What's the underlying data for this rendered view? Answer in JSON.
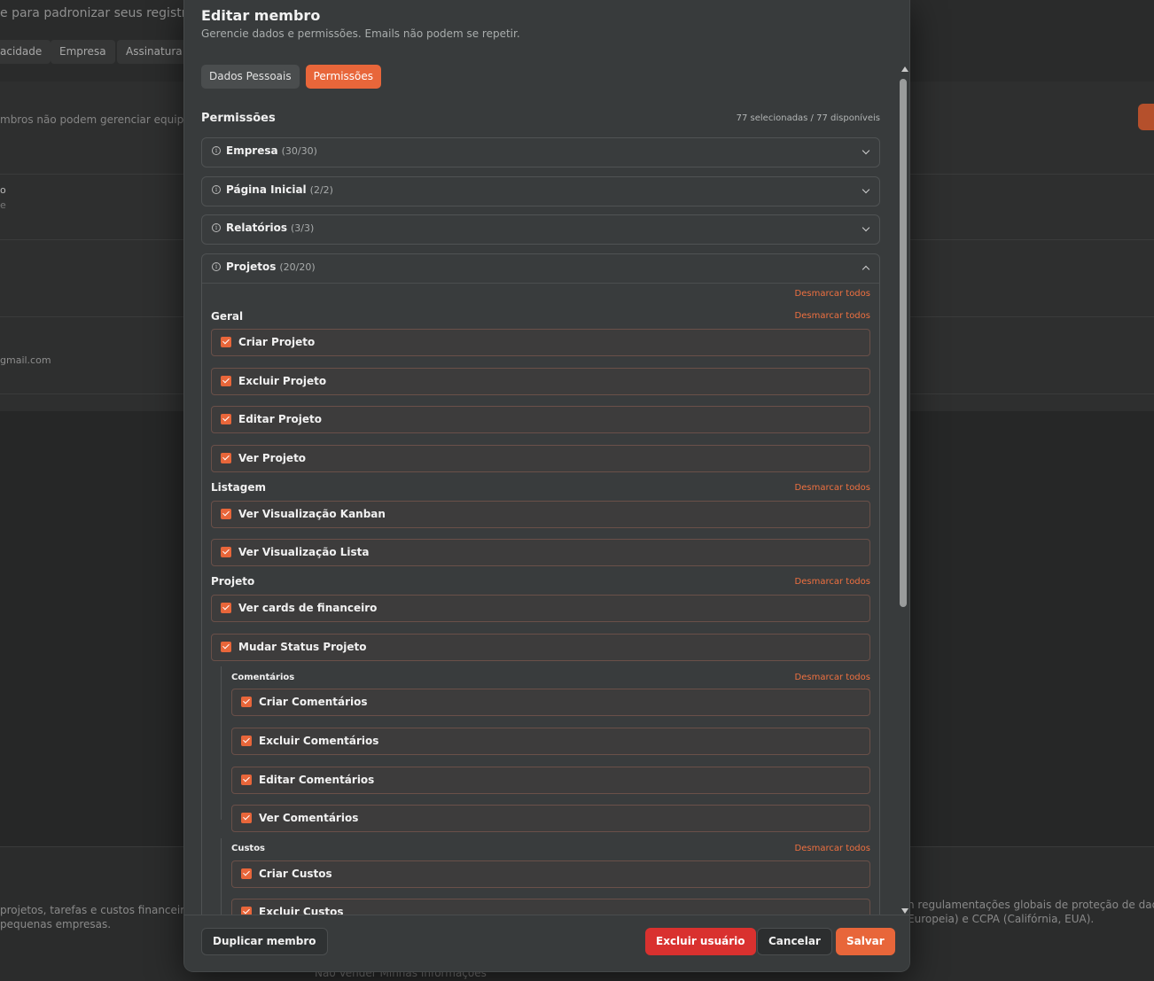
{
  "background": {
    "subtitle": "e para padronizar seus registros.",
    "tabs": [
      "acidade",
      "Empresa",
      "Assinatura"
    ],
    "note": "mbros não podem gerenciar equipe o",
    "row_a": "o",
    "row_b": "e",
    "email": "gmail.com",
    "footer_left_1": "projetos, tarefas e custos financeiros",
    "footer_left_2": "pequenas empresas.",
    "footer_right_1": "n regulamentações globais de proteção de dados,",
    "footer_right_2": "Europeia) e CCPA (Califórnia, EUA).",
    "footer_link": "Não Vender Minhas Informações"
  },
  "modal": {
    "title": "Editar membro",
    "subtitle": "Gerencie dados e permissões. Emails não podem se repetir.",
    "tabs": {
      "personal": "Dados Pessoais",
      "permissions": "Permissões"
    },
    "permissions_heading": "Permissões",
    "permissions_count": "77 selecionadas / 77 disponíveis",
    "unmark_label": "Desmarcar todos",
    "sections": [
      {
        "name": "Empresa",
        "count": "(30/30)"
      },
      {
        "name": "Página Inicial",
        "count": "(2/2)"
      },
      {
        "name": "Relatórios",
        "count": "(3/3)"
      },
      {
        "name": "Projetos",
        "count": "(20/20)"
      }
    ],
    "projetos": {
      "geral": {
        "title": "Geral",
        "items": [
          "Criar Projeto",
          "Excluir Projeto",
          "Editar Projeto",
          "Ver Projeto"
        ]
      },
      "listagem": {
        "title": "Listagem",
        "items": [
          "Ver Visualização Kanban",
          "Ver Visualização Lista"
        ]
      },
      "projeto": {
        "title": "Projeto",
        "items": [
          "Ver cards de financeiro",
          "Mudar Status Projeto"
        ]
      },
      "comentarios": {
        "title": "Comentários",
        "items": [
          "Criar Comentários",
          "Excluir Comentários",
          "Editar Comentários",
          "Ver Comentários"
        ]
      },
      "custos": {
        "title": "Custos",
        "items": [
          "Criar Custos",
          "Excluir Custos"
        ]
      }
    },
    "footer": {
      "duplicate": "Duplicar membro",
      "delete": "Excluir usuário",
      "cancel": "Cancelar",
      "save": "Salvar"
    }
  },
  "colors": {
    "accent": "#e8663a",
    "danger": "#d9312f"
  }
}
